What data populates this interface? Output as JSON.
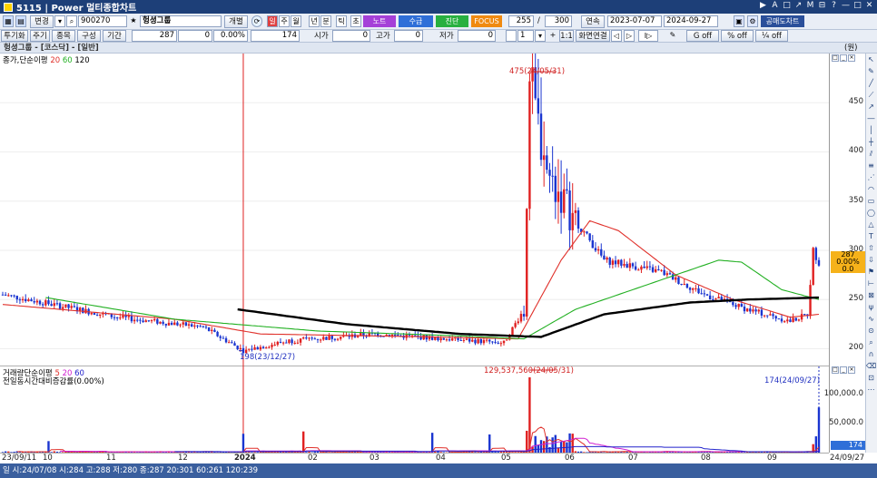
{
  "window": {
    "title": "5115 | Power 멀티종합차트",
    "controls": [
      "▶",
      "A",
      "□",
      "↗",
      "M",
      "⊟",
      "?",
      "—",
      "□",
      "✕"
    ]
  },
  "toolbar1": {
    "change_btn": "변경",
    "code_value": "900270",
    "name_value": "헝셩그룹",
    "individual_btn": "개별",
    "periods": [
      "일",
      "주",
      "월",
      "년",
      "분",
      "틱",
      "초"
    ],
    "note_btn": "노트",
    "supply_btn": "수급",
    "diag_btn": "진단",
    "focus_btn": "FOCUS",
    "count_value": "255",
    "slash": "/",
    "total_value": "300",
    "continuous_btn": "연속",
    "date_from": "2023-07-07",
    "date_to": "2024-09-27",
    "disclosure_btn": "공매도차트"
  },
  "toolbar2": {
    "investor_btn": "투기화",
    "period_btn": "주기",
    "item_btn": "종목",
    "config_btn": "구성",
    "term_btn": "기간",
    "price": "287",
    "change": "0",
    "rate": "0.00%",
    "volume_val": "174",
    "open_label": "시가",
    "open_val": "0",
    "high_label": "고가",
    "high_val": "0",
    "low_label": "저가",
    "low_val": "0",
    "page_val": "1",
    "ratio_btn": "1:1",
    "screen_btn": "화면연결",
    "off1": "off",
    "off2": "off",
    "off3": "off"
  },
  "header3": {
    "stock_title": "헝셩그룹 - [코스닥] - [일반]",
    "unit": "(원)"
  },
  "price_pane": {
    "legend_prefix": "종가,단순이평",
    "ma_periods": [
      "20",
      "60",
      "120"
    ],
    "ma_colors": [
      "#e0302a",
      "#22b022",
      "#000000"
    ],
    "high_annotation": "475(24/05/31)",
    "low_annotation": "198(23/12/27)",
    "current_price_tag": "287",
    "current_rate_tag": "0.00%",
    "current_change_tag": "0.0"
  },
  "volume_pane": {
    "legend_line1_prefix": "거래량단순이평",
    "vol_ma_periods": [
      "5",
      "20",
      "60"
    ],
    "vol_ma_colors": [
      "#e0302a",
      "#d020d0",
      "#2222cc"
    ],
    "legend_line2": "전일동시간대비증감률(0.00%)",
    "max_annotation": "129,537,560(24/05/31)",
    "last_annotation": "174(24/09/27)",
    "current_tag": "174"
  },
  "x_axis_labels": [
    "23/09/11",
    "10",
    "11",
    "12",
    "2024",
    "02",
    "03",
    "04",
    "05",
    "06",
    "07",
    "08",
    "09",
    "24/09/27"
  ],
  "status_bar": "일 시:24/07/08 시:284 고:288 저:280 종:287 20:301 60:261 120:239",
  "chart_data": [
    {
      "type": "candlestick",
      "title": "헝셩그룹 - [코스닥] - [일반]",
      "ylabel": "(원)",
      "ylim": [
        182,
        500
      ],
      "y_ticks": [
        200,
        250,
        300,
        350,
        400,
        450
      ],
      "x_range": [
        "23/09/11",
        "24/09/27"
      ],
      "series": [
        {
          "name": "종가",
          "keypoints": [
            [
              0,
              255
            ],
            [
              40,
              232
            ],
            [
              70,
              222
            ],
            [
              84,
              198
            ],
            [
              100,
              208
            ],
            [
              130,
              215
            ],
            [
              155,
              210
            ],
            [
              175,
              206
            ],
            [
              182,
              240
            ],
            [
              184,
              475
            ],
            [
              190,
              380
            ],
            [
              200,
              330
            ],
            [
              210,
              290
            ],
            [
              230,
              278
            ],
            [
              245,
              255
            ],
            [
              260,
              240
            ],
            [
              275,
              228
            ],
            [
              281,
              235
            ],
            [
              283,
              300
            ],
            [
              285,
              287
            ]
          ]
        },
        {
          "name": "20",
          "keypoints": [
            [
              0,
              245
            ],
            [
              60,
              230
            ],
            [
              90,
              215
            ],
            [
              150,
              212
            ],
            [
              180,
              210
            ],
            [
              195,
              290
            ],
            [
              205,
              330
            ],
            [
              215,
              320
            ],
            [
              235,
              275
            ],
            [
              255,
              250
            ],
            [
              275,
              232
            ],
            [
              285,
              235
            ]
          ]
        },
        {
          "name": "60",
          "keypoints": [
            [
              15,
              252
            ],
            [
              60,
              230
            ],
            [
              110,
              218
            ],
            [
              160,
              213
            ],
            [
              182,
              210
            ],
            [
              200,
              240
            ],
            [
              230,
              270
            ],
            [
              250,
              290
            ],
            [
              258,
              288
            ],
            [
              272,
              260
            ],
            [
              285,
              250
            ]
          ]
        },
        {
          "name": "120",
          "keypoints": [
            [
              82,
              240
            ],
            [
              120,
              225
            ],
            [
              160,
              215
            ],
            [
              188,
              212
            ],
            [
              210,
              235
            ],
            [
              240,
              247
            ],
            [
              260,
              250
            ],
            [
              285,
              252
            ]
          ]
        }
      ],
      "annotations": [
        "475(24/05/31)",
        "198(23/12/27)"
      ],
      "current": {
        "price": 287,
        "rate": "0.00%",
        "change": 0.0
      }
    },
    {
      "type": "bar",
      "title": "거래량단순이평",
      "series_names": [
        "5",
        "20",
        "60"
      ],
      "ylim": [
        0,
        129537560
      ],
      "y_ticks": [
        50000000,
        100000000
      ],
      "y_tick_labels": [
        "50,000.0",
        "100,000.0"
      ],
      "peak": {
        "date": "24/05/31",
        "value": 129537560
      },
      "last": {
        "date": "24/09/27",
        "value": 174
      }
    }
  ]
}
